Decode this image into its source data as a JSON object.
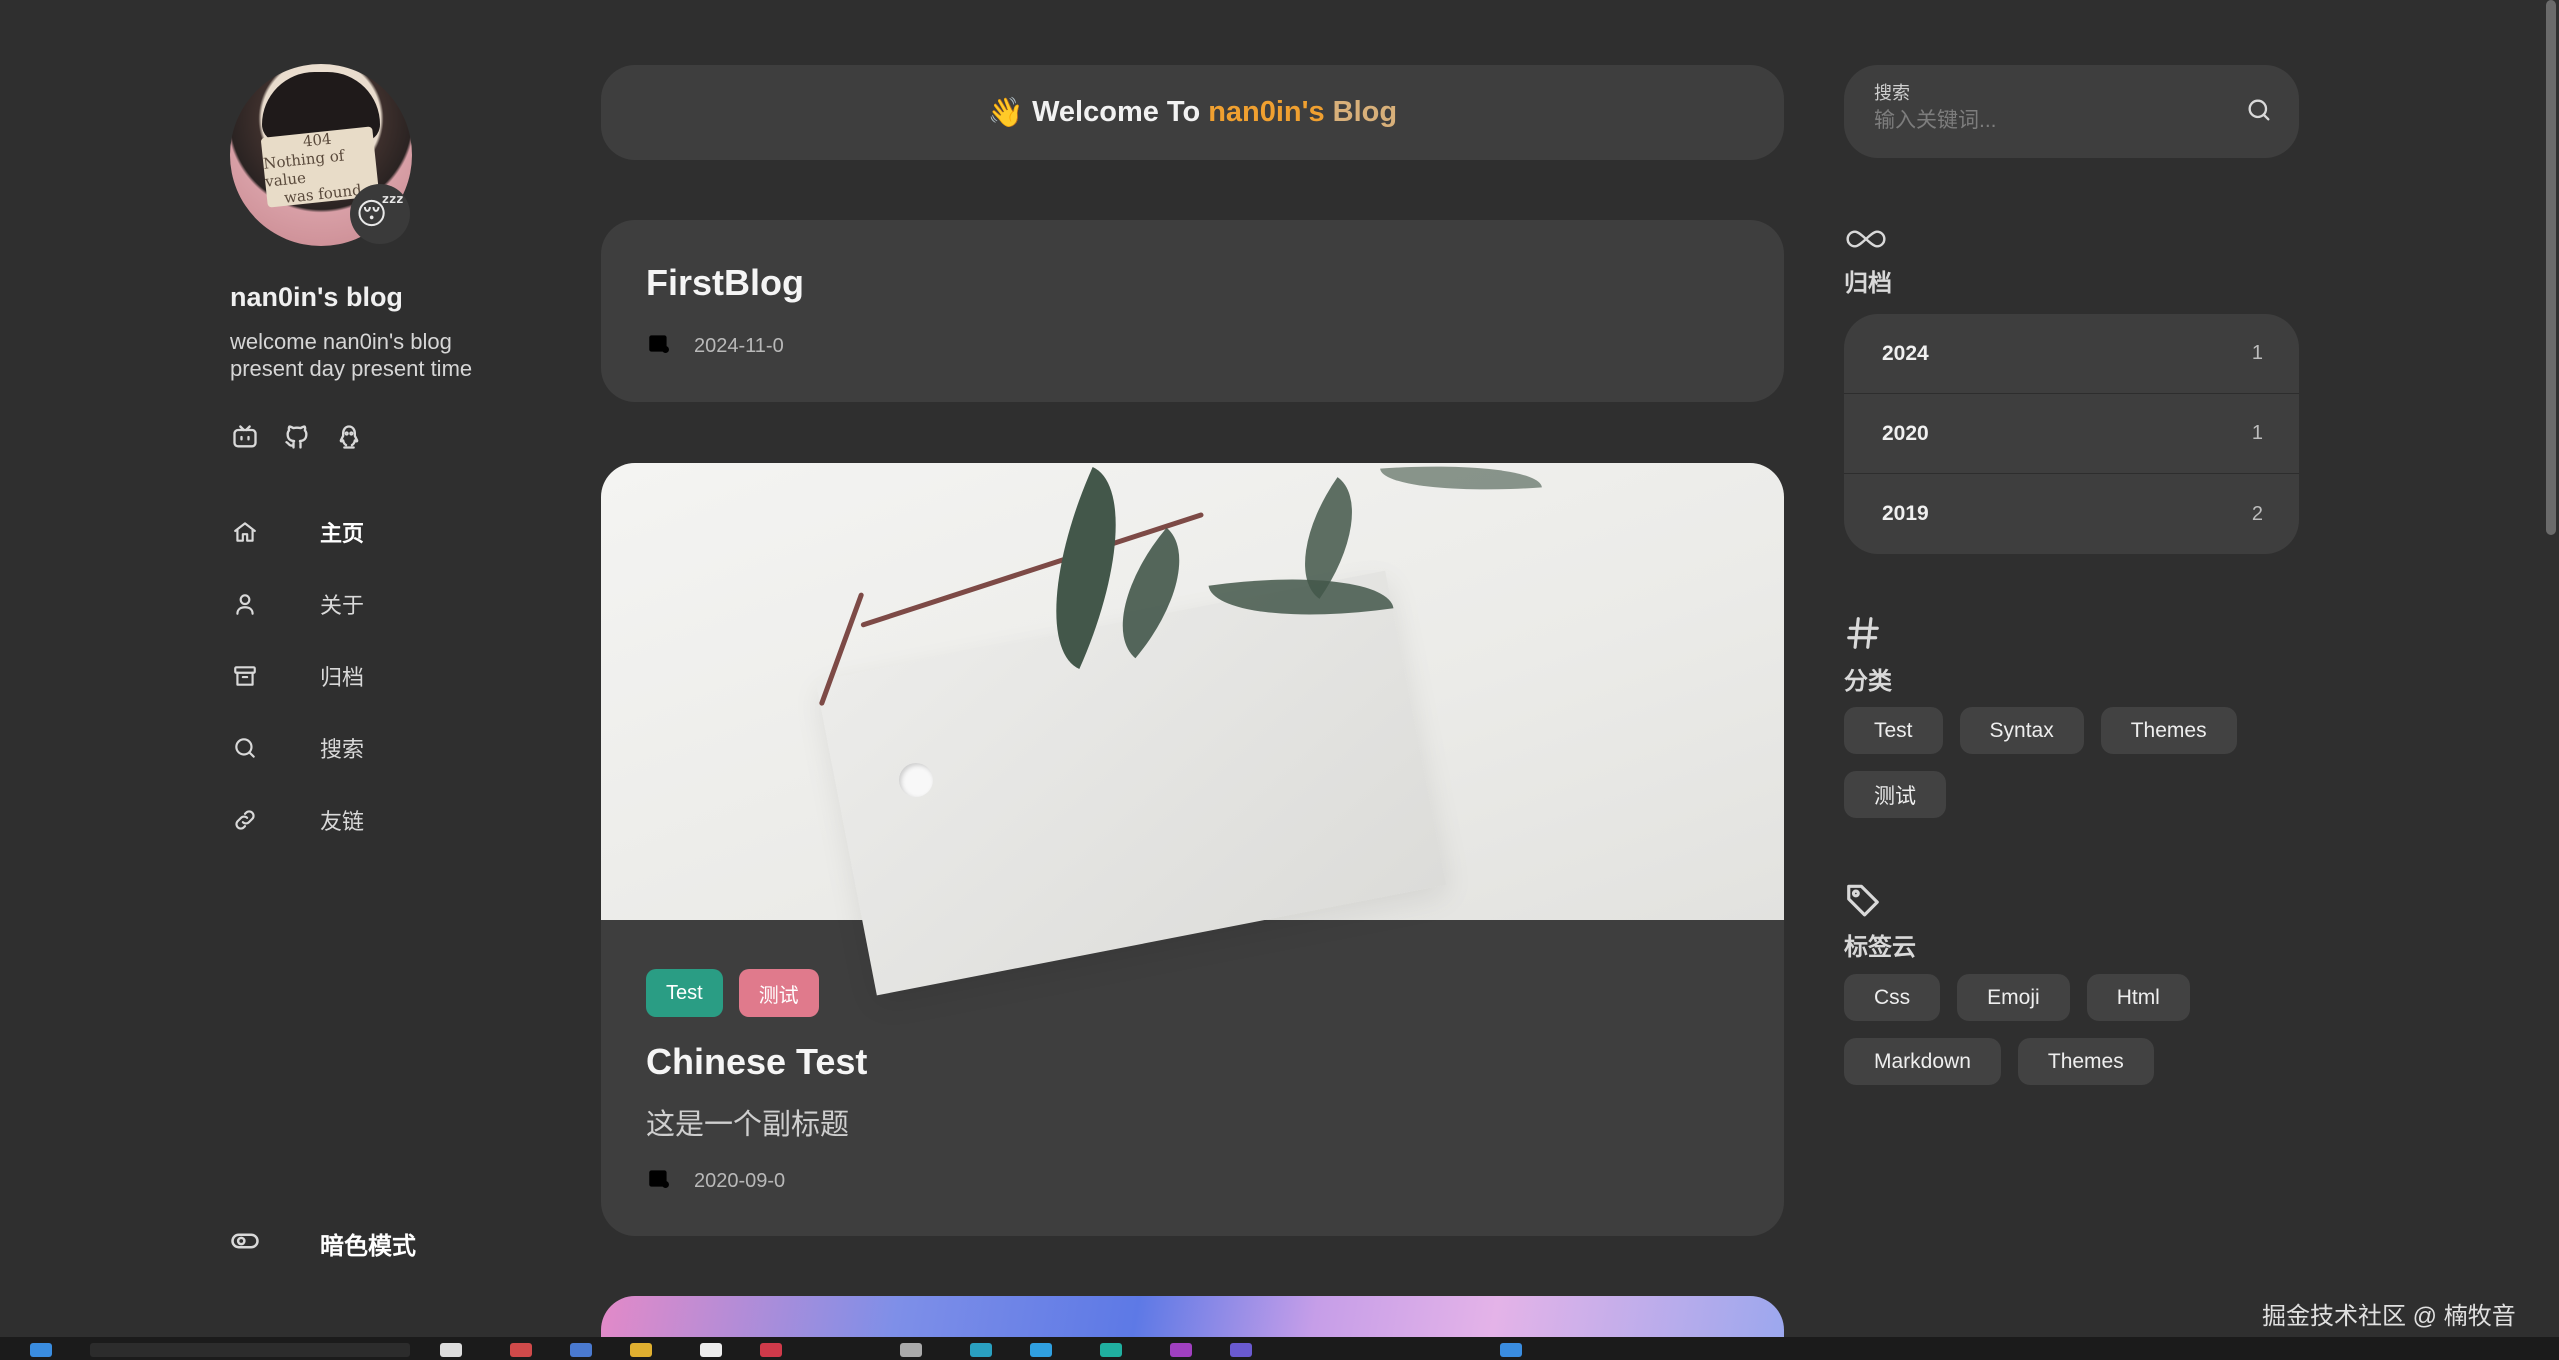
{
  "profile": {
    "name": "nan0in's blog",
    "description_line1": "welcome nan0in's blog",
    "description_line2": "present day present time",
    "avatar_sign_text": [
      "404",
      "Nothing of value",
      "was found"
    ],
    "avatar_badge_emoji": "😴"
  },
  "socials": [
    {
      "icon": "bilibili-icon"
    },
    {
      "icon": "github-icon"
    },
    {
      "icon": "qq-icon"
    }
  ],
  "nav": [
    {
      "label": "主页",
      "icon": "home-icon",
      "active": true
    },
    {
      "label": "关于",
      "icon": "user-icon",
      "active": false
    },
    {
      "label": "归档",
      "icon": "archive-icon",
      "active": false
    },
    {
      "label": "搜索",
      "icon": "search-icon",
      "active": false
    },
    {
      "label": "友链",
      "icon": "link-icon",
      "active": false
    }
  ],
  "dark_mode": {
    "label": "暗色模式",
    "icon": "toggle-icon"
  },
  "welcome": {
    "emoji": "👋",
    "prefix": "Welcome To",
    "highlight": "nan0in's",
    "suffix": "Blog"
  },
  "posts": [
    {
      "title": "FirstBlog",
      "date": "2024-11-0"
    },
    {
      "title": "Chinese Test",
      "subtitle": "这是一个副标题",
      "date": "2020-09-0",
      "tags": [
        "Test",
        "测试"
      ]
    }
  ],
  "search": {
    "label": "搜索",
    "placeholder": "输入关键词..."
  },
  "archive": {
    "title": "归档",
    "icon": "infinity-icon",
    "rows": [
      {
        "year": "2024",
        "count": "1"
      },
      {
        "year": "2020",
        "count": "1"
      },
      {
        "year": "2019",
        "count": "2"
      }
    ]
  },
  "categories": {
    "title": "分类",
    "icon": "hash-icon",
    "items": [
      "Test",
      "Syntax",
      "Themes",
      "测试"
    ]
  },
  "tagcloud": {
    "title": "标签云",
    "icon": "tag-icon",
    "items": [
      "Css",
      "Emoji",
      "Html",
      "Markdown",
      "Themes"
    ]
  },
  "watermark": "掘金技术社区 @ 楠牧音",
  "colors": {
    "background": "#2f2f2f",
    "card": "#3e3e3e",
    "accent_orange": "#f0a030",
    "tag_teal": "#2a9d84",
    "tag_pink": "#e07a8c"
  }
}
